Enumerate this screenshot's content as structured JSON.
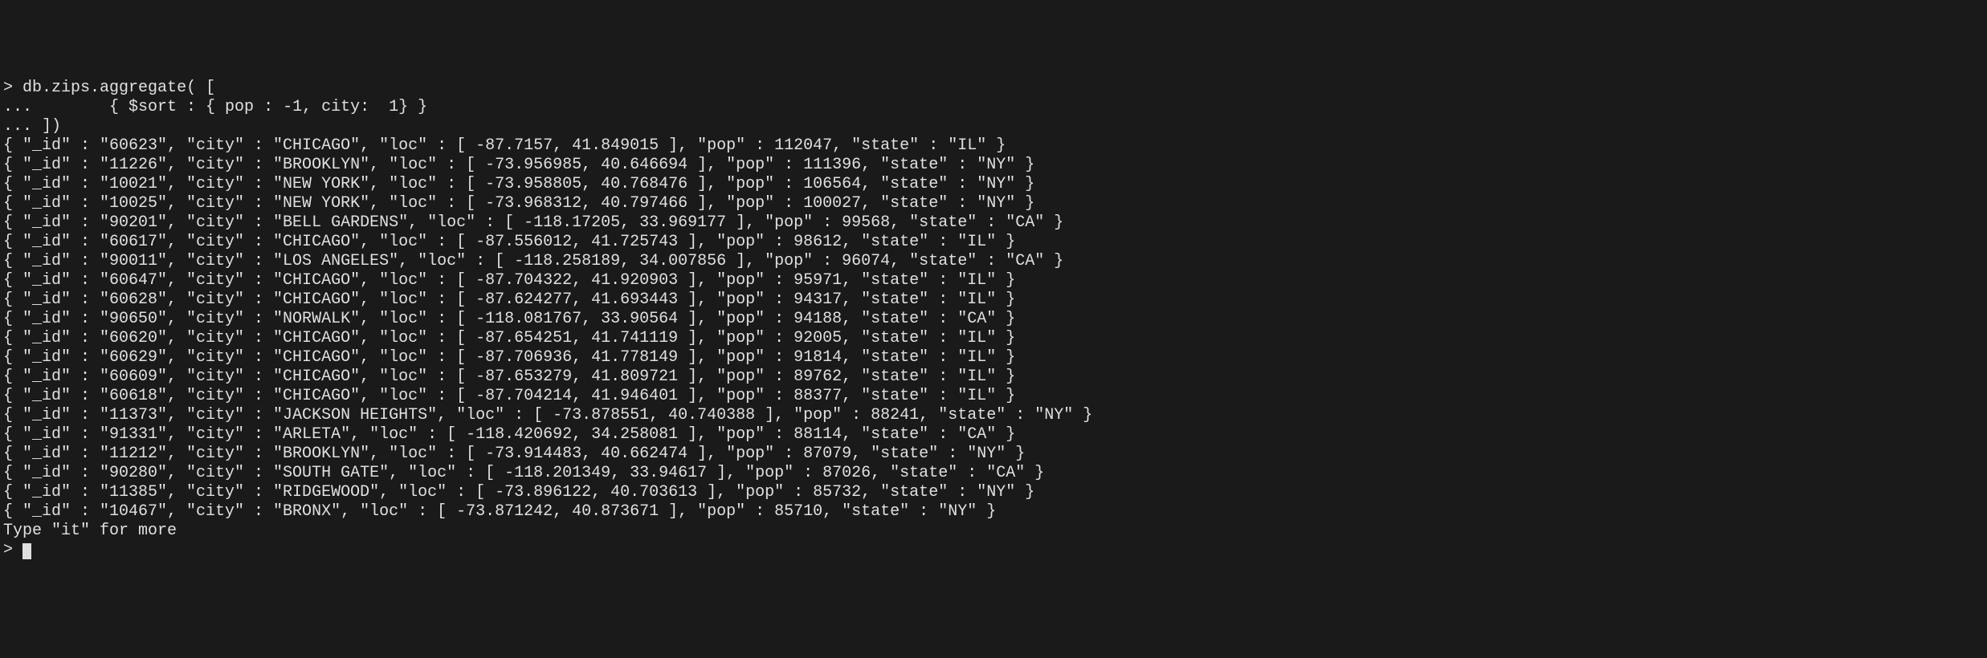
{
  "command": {
    "prompt": ">",
    "line1": "db.zips.aggregate( [",
    "cont_prompt": "...",
    "line2": "        { $sort : { pop : -1, city:  1} }",
    "line3": "... ])"
  },
  "results": [
    "{ \"_id\" : \"60623\", \"city\" : \"CHICAGO\", \"loc\" : [ -87.7157, 41.849015 ], \"pop\" : 112047, \"state\" : \"IL\" }",
    "{ \"_id\" : \"11226\", \"city\" : \"BROOKLYN\", \"loc\" : [ -73.956985, 40.646694 ], \"pop\" : 111396, \"state\" : \"NY\" }",
    "{ \"_id\" : \"10021\", \"city\" : \"NEW YORK\", \"loc\" : [ -73.958805, 40.768476 ], \"pop\" : 106564, \"state\" : \"NY\" }",
    "{ \"_id\" : \"10025\", \"city\" : \"NEW YORK\", \"loc\" : [ -73.968312, 40.797466 ], \"pop\" : 100027, \"state\" : \"NY\" }",
    "{ \"_id\" : \"90201\", \"city\" : \"BELL GARDENS\", \"loc\" : [ -118.17205, 33.969177 ], \"pop\" : 99568, \"state\" : \"CA\" }",
    "{ \"_id\" : \"60617\", \"city\" : \"CHICAGO\", \"loc\" : [ -87.556012, 41.725743 ], \"pop\" : 98612, \"state\" : \"IL\" }",
    "{ \"_id\" : \"90011\", \"city\" : \"LOS ANGELES\", \"loc\" : [ -118.258189, 34.007856 ], \"pop\" : 96074, \"state\" : \"CA\" }",
    "{ \"_id\" : \"60647\", \"city\" : \"CHICAGO\", \"loc\" : [ -87.704322, 41.920903 ], \"pop\" : 95971, \"state\" : \"IL\" }",
    "{ \"_id\" : \"60628\", \"city\" : \"CHICAGO\", \"loc\" : [ -87.624277, 41.693443 ], \"pop\" : 94317, \"state\" : \"IL\" }",
    "{ \"_id\" : \"90650\", \"city\" : \"NORWALK\", \"loc\" : [ -118.081767, 33.90564 ], \"pop\" : 94188, \"state\" : \"CA\" }",
    "{ \"_id\" : \"60620\", \"city\" : \"CHICAGO\", \"loc\" : [ -87.654251, 41.741119 ], \"pop\" : 92005, \"state\" : \"IL\" }",
    "{ \"_id\" : \"60629\", \"city\" : \"CHICAGO\", \"loc\" : [ -87.706936, 41.778149 ], \"pop\" : 91814, \"state\" : \"IL\" }",
    "{ \"_id\" : \"60609\", \"city\" : \"CHICAGO\", \"loc\" : [ -87.653279, 41.809721 ], \"pop\" : 89762, \"state\" : \"IL\" }",
    "{ \"_id\" : \"60618\", \"city\" : \"CHICAGO\", \"loc\" : [ -87.704214, 41.946401 ], \"pop\" : 88377, \"state\" : \"IL\" }",
    "{ \"_id\" : \"11373\", \"city\" : \"JACKSON HEIGHTS\", \"loc\" : [ -73.878551, 40.740388 ], \"pop\" : 88241, \"state\" : \"NY\" }",
    "{ \"_id\" : \"91331\", \"city\" : \"ARLETA\", \"loc\" : [ -118.420692, 34.258081 ], \"pop\" : 88114, \"state\" : \"CA\" }",
    "{ \"_id\" : \"11212\", \"city\" : \"BROOKLYN\", \"loc\" : [ -73.914483, 40.662474 ], \"pop\" : 87079, \"state\" : \"NY\" }",
    "{ \"_id\" : \"90280\", \"city\" : \"SOUTH GATE\", \"loc\" : [ -118.201349, 33.94617 ], \"pop\" : 87026, \"state\" : \"CA\" }",
    "{ \"_id\" : \"11385\", \"city\" : \"RIDGEWOOD\", \"loc\" : [ -73.896122, 40.703613 ], \"pop\" : 85732, \"state\" : \"NY\" }",
    "{ \"_id\" : \"10467\", \"city\" : \"BRONX\", \"loc\" : [ -73.871242, 40.873671 ], \"pop\" : 85710, \"state\" : \"NY\" }"
  ],
  "footer": "Type \"it\" for more",
  "next_prompt": ">"
}
